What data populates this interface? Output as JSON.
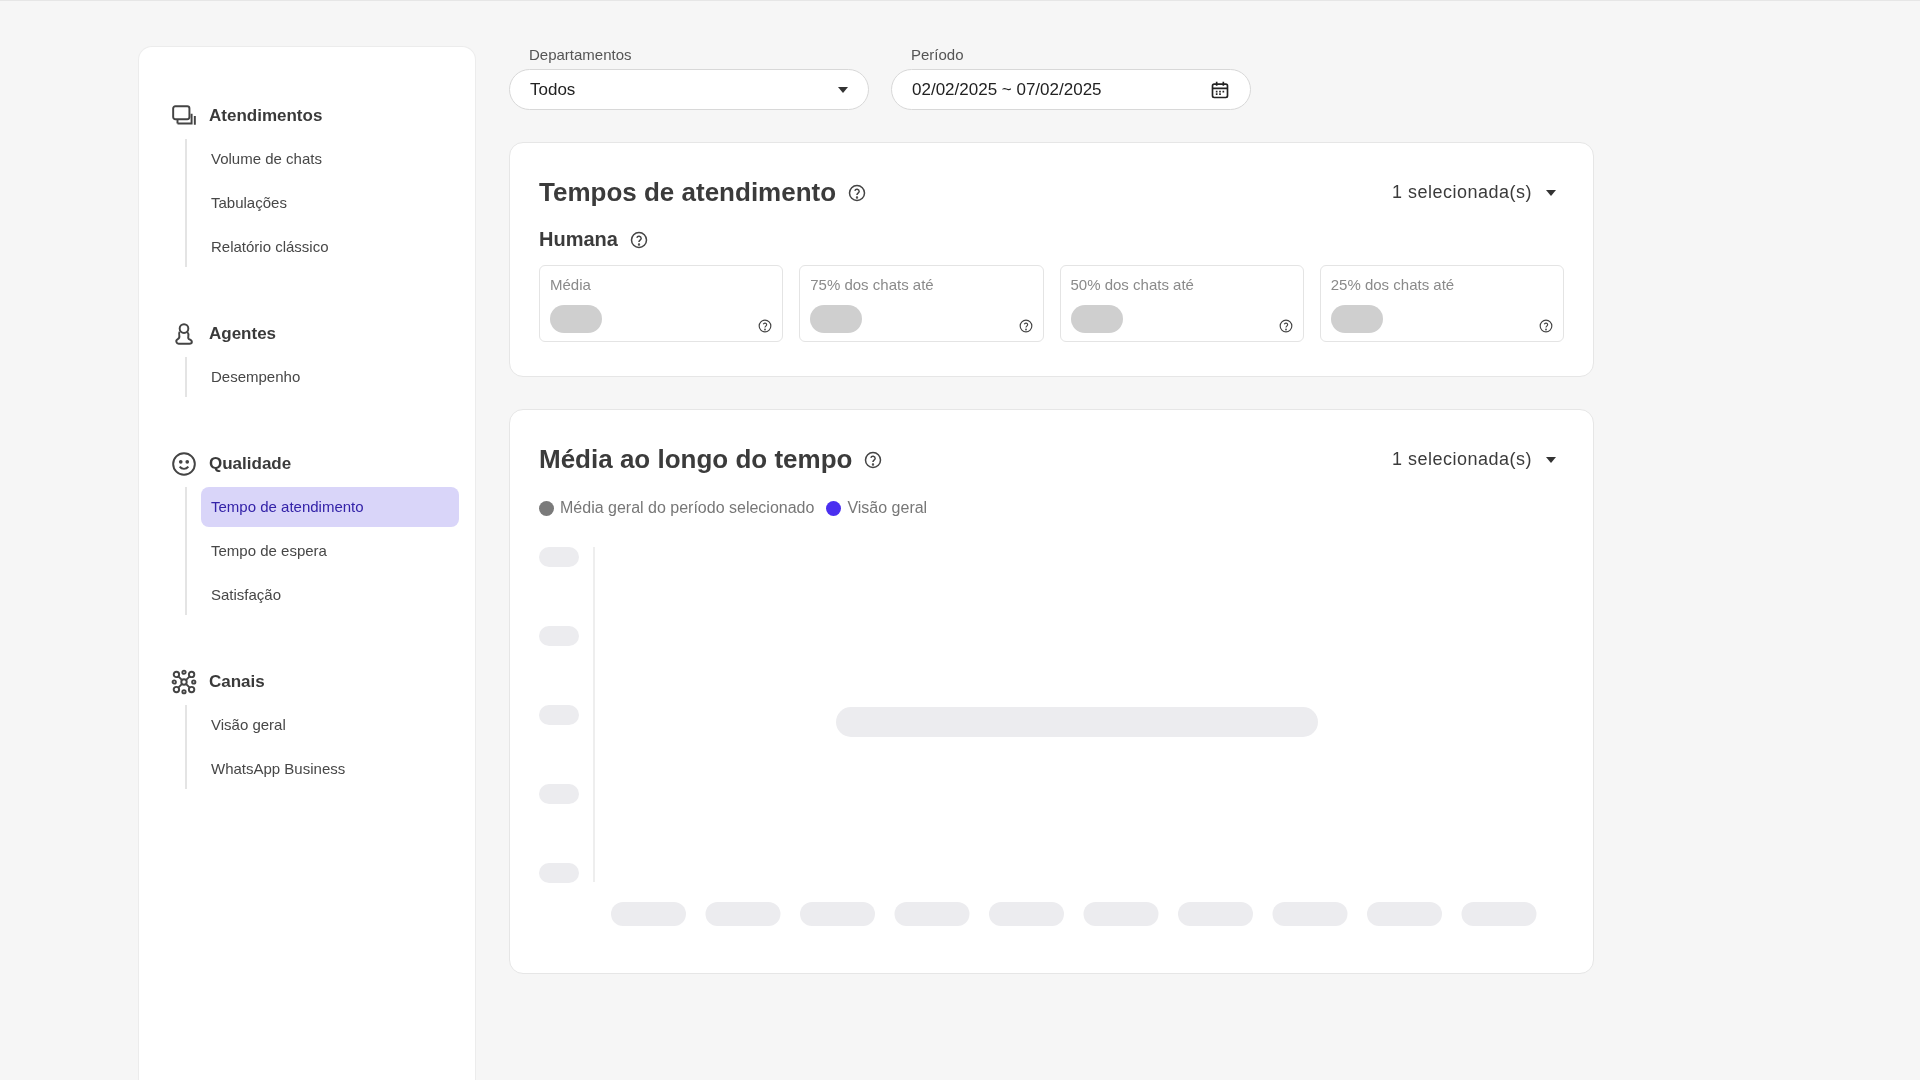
{
  "sidebar": {
    "groups": [
      {
        "title": "Atendimentos",
        "items": [
          {
            "label": "Volume de chats",
            "selected": false
          },
          {
            "label": "Tabulações",
            "selected": false
          },
          {
            "label": "Relatório clássico",
            "selected": false
          }
        ]
      },
      {
        "title": "Agentes",
        "items": [
          {
            "label": "Desempenho",
            "selected": false
          }
        ]
      },
      {
        "title": "Qualidade",
        "items": [
          {
            "label": "Tempo de atendimento",
            "selected": true
          },
          {
            "label": "Tempo de espera",
            "selected": false
          },
          {
            "label": "Satisfação",
            "selected": false
          }
        ]
      },
      {
        "title": "Canais",
        "items": [
          {
            "label": "Visão geral",
            "selected": false
          },
          {
            "label": "WhatsApp Business",
            "selected": false
          }
        ]
      }
    ]
  },
  "filters": {
    "department": {
      "label": "Departamentos",
      "value": "Todos"
    },
    "period": {
      "label": "Período",
      "value": "02/02/2025 ~ 07/02/2025"
    }
  },
  "times_card": {
    "title": "Tempos de atendimento",
    "selector": "1 selecionada(s)",
    "section": "Humana",
    "metrics": [
      {
        "label": "Média"
      },
      {
        "label": "75% dos chats até"
      },
      {
        "label": "50% dos chats até"
      },
      {
        "label": "25% dos chats até"
      }
    ]
  },
  "trend_card": {
    "title": "Média ao longo do tempo",
    "selector": "1 selecionada(s)",
    "legend": [
      {
        "label": "Média geral do período selecionado",
        "color": "#7a7a7a"
      },
      {
        "label": "Visão geral",
        "color": "#4a2ff0"
      }
    ]
  }
}
